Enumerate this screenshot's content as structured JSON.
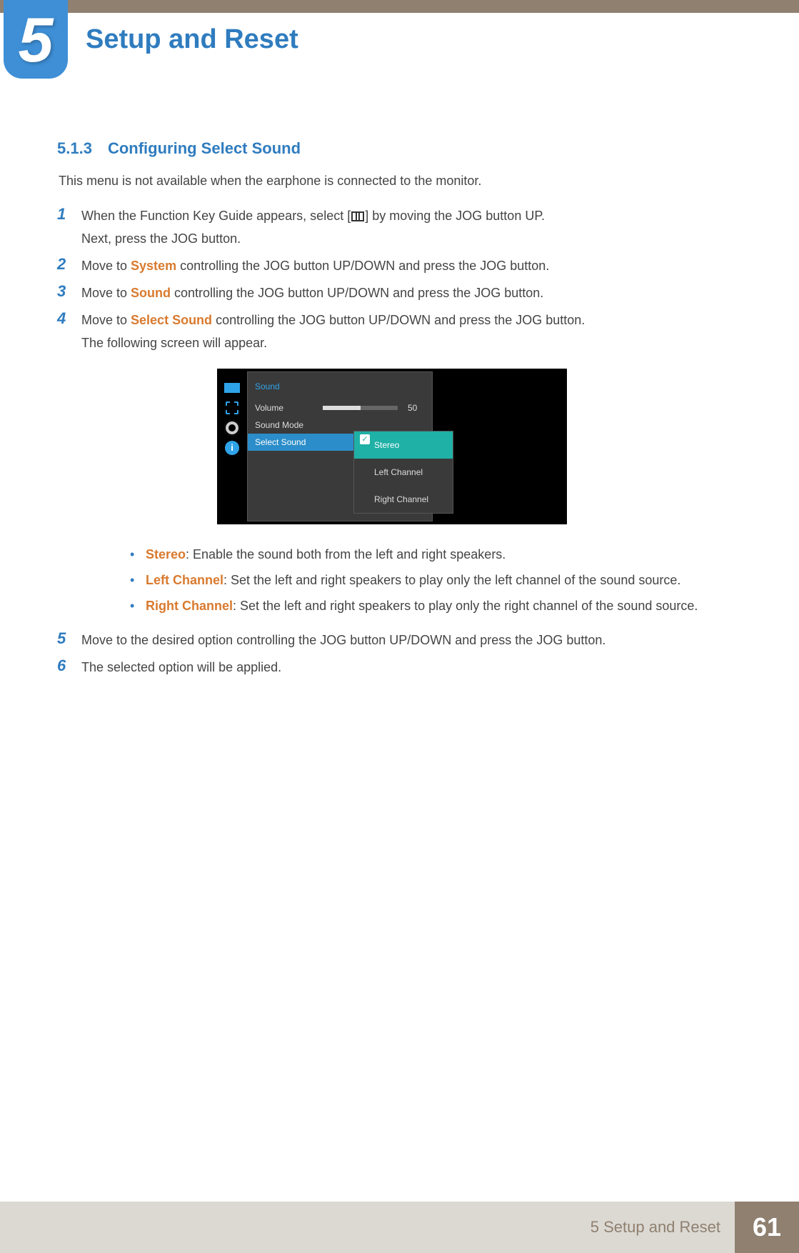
{
  "chapter": {
    "number": "5",
    "title": "Setup and Reset"
  },
  "section": {
    "number": "5.1.3",
    "title": "Configuring Select Sound"
  },
  "intro": "This menu is not available when the earphone is connected to the monitor.",
  "steps": {
    "s1a": "When the Function Key Guide appears, select [",
    "s1b": "] by moving the JOG button UP.",
    "s1c": "Next, press the JOG button.",
    "s2a": "Move to ",
    "s2hl": "System",
    "s2b": " controlling the JOG button UP/DOWN and press the JOG button.",
    "s3a": "Move to ",
    "s3hl": "Sound",
    "s3b": " controlling the JOG button UP/DOWN and press the JOG button.",
    "s4a": "Move to ",
    "s4hl": "Select Sound",
    "s4b": " controlling the JOG button UP/DOWN and press the JOG button.",
    "s4c": "The following screen will appear.",
    "s5": "Move to the desired option controlling the JOG button UP/DOWN and press the JOG button.",
    "s6": "The selected option will be applied."
  },
  "osd": {
    "title": "Sound",
    "rows": {
      "volume": "Volume",
      "volume_value": "50",
      "soundmode": "Sound Mode",
      "selectsound": "Select Sound"
    },
    "submenu": {
      "stereo": "Stereo",
      "left": "Left Channel",
      "right": "Right Channel"
    },
    "info_glyph": "i"
  },
  "options": {
    "o1hl": "Stereo",
    "o1": ": Enable the sound both from the left and right speakers.",
    "o2hl": "Left Channel",
    "o2": ": Set the left and right speakers to play only the left channel of the sound source.",
    "o3hl": "Right Channel",
    "o3": ": Set the left and right speakers to play only the right channel of the sound source."
  },
  "footer": {
    "section": "5 Setup and Reset",
    "page": "61"
  }
}
